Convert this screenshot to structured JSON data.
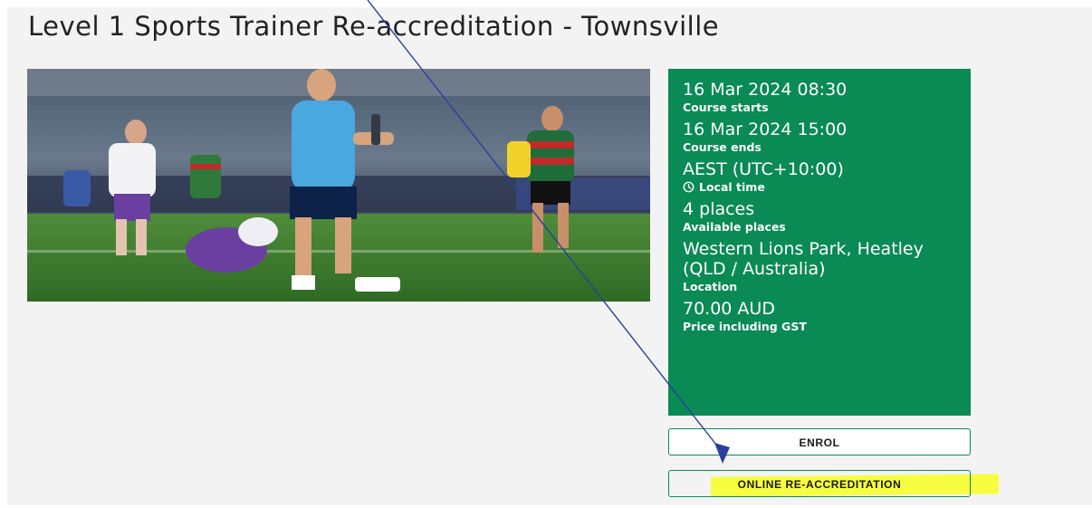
{
  "page": {
    "title": "Level 1 Sports Trainer Re-accreditation - Townsville"
  },
  "course_info": {
    "start_value": "16 Mar 2024 08:30",
    "start_label": "Course starts",
    "end_value": "16 Mar 2024 15:00",
    "end_label": "Course ends",
    "timezone_value": "AEST (UTC+10:00)",
    "timezone_label": "Local time",
    "places_value": "4 places",
    "places_label": "Available places",
    "location_value": "Western Lions Park, Heatley (QLD / Australia)",
    "location_label": "Location",
    "price_value": "70.00 AUD",
    "price_label": "Price including GST"
  },
  "actions": {
    "enrol_label": "ENROL",
    "online_reaccreditation_label": "ONLINE RE-ACCREDITATION"
  },
  "icons": {
    "clock": "clock-icon"
  },
  "colors": {
    "card_green": "#0a8a55",
    "highlight_yellow": "#f7ff2e",
    "annotation_arrow": "#2a3f9d"
  }
}
